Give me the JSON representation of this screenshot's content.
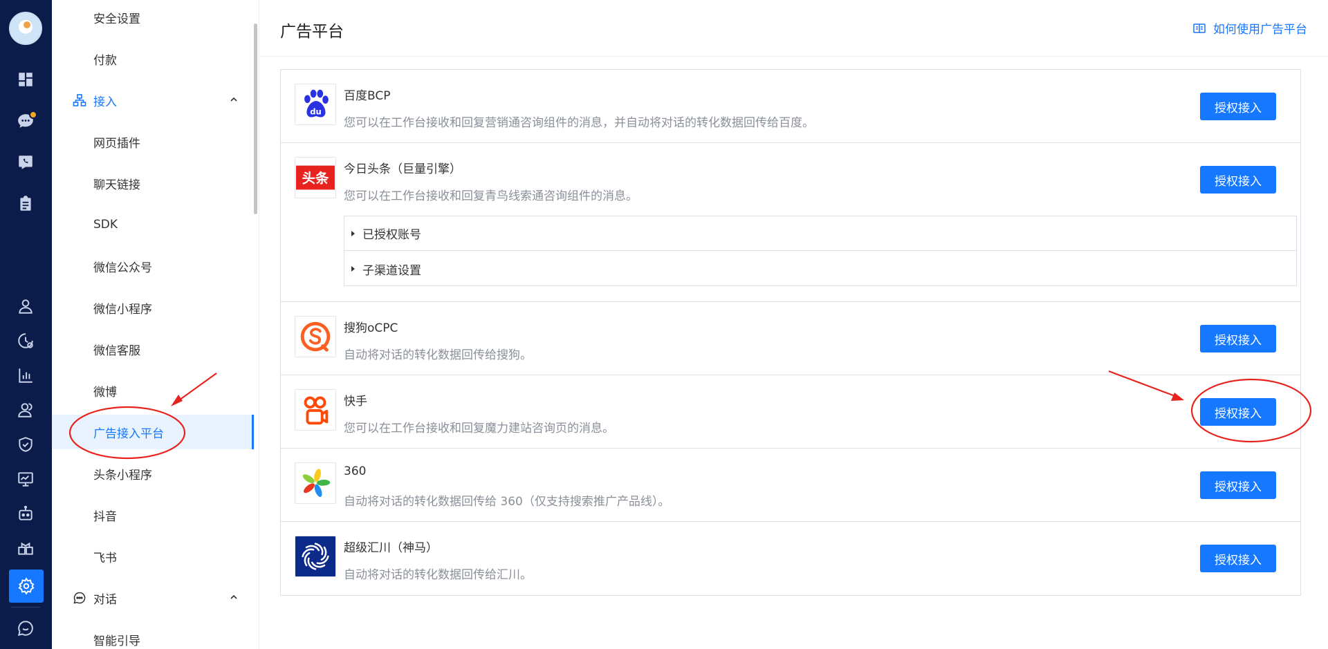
{
  "rail": {
    "avatar": "avatar",
    "icons": [
      "dashboard-icon",
      "chat-icon",
      "phone-icon",
      "clipboard-icon",
      "contact-icon",
      "history-icon",
      "chart-icon",
      "team-icon",
      "shield-icon",
      "monitor-icon",
      "robot-icon",
      "apps-icon",
      "settings-icon",
      "message-icon"
    ],
    "active": "settings-icon",
    "badge_color": "#f5a623"
  },
  "subnav": {
    "items_top": [
      {
        "label": "安全设置"
      },
      {
        "label": "付款"
      }
    ],
    "group_access": {
      "label": "接入",
      "icon": "sitemap-icon",
      "expanded": true
    },
    "access_items": [
      {
        "label": "网页插件"
      },
      {
        "label": "聊天链接"
      },
      {
        "label": "SDK"
      },
      {
        "label": "微信公众号"
      },
      {
        "label": "微信小程序"
      },
      {
        "label": "微信客服"
      },
      {
        "label": "微博"
      },
      {
        "label": "广告接入平台",
        "active": true
      },
      {
        "label": "头条小程序"
      },
      {
        "label": "抖音"
      },
      {
        "label": "飞书"
      }
    ],
    "group_dialog": {
      "label": "对话",
      "icon": "chat-bubble-icon",
      "expanded": true
    },
    "dialog_items": [
      {
        "label": "智能引导"
      }
    ]
  },
  "header": {
    "title": "广告平台",
    "help_link": "如何使用广告平台",
    "help_icon": "book-icon"
  },
  "platforms": [
    {
      "name": "百度BCP",
      "desc": "您可以在工作台接收和回复营销通咨询组件的消息，并自动将对话的转化数据回传给百度。",
      "button": "授权接入",
      "logo": "baidu-logo"
    },
    {
      "name": "今日头条（巨量引擎）",
      "desc": "您可以在工作台接收和回复青鸟线索通咨询组件的消息。",
      "button": "授权接入",
      "logo": "toutiao-logo",
      "sub_rows": [
        "已授权账号",
        "子渠道设置"
      ]
    },
    {
      "name": "搜狗oCPC",
      "desc": "自动将对话的转化数据回传给搜狗。",
      "button": "授权接入",
      "logo": "sogou-logo"
    },
    {
      "name": "快手",
      "desc": "您可以在工作台接收和回复魔力建站咨询页的消息。",
      "button": "授权接入",
      "logo": "kuaishou-logo"
    },
    {
      "name": "360",
      "desc": "自动将对话的转化数据回传给 360（仅支持搜索推广产品线）。",
      "button": "授权接入",
      "logo": "360-logo"
    },
    {
      "name": "超级汇川（神马）",
      "desc": "自动将对话的转化数据回传给汇川。",
      "button": "授权接入",
      "logo": "huichuan-logo"
    }
  ],
  "colors": {
    "primary": "#1677ff",
    "rail_bg": "#0b1c4a",
    "annotation": "#e8231d"
  }
}
